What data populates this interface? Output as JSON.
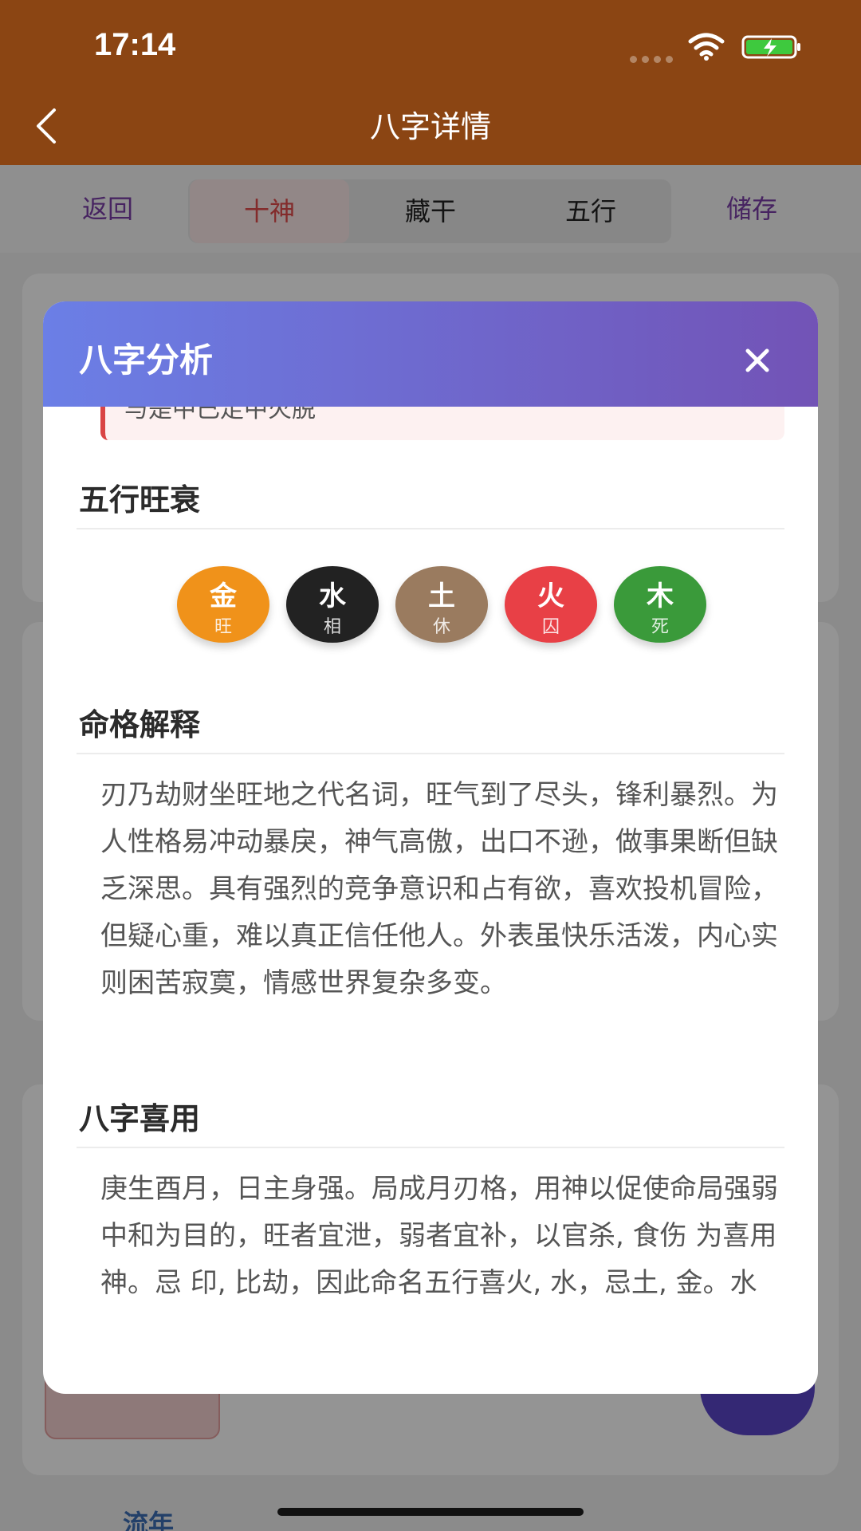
{
  "status_bar": {
    "time": "17:14"
  },
  "header": {
    "title": "八字详情"
  },
  "toolbar": {
    "back_label": "返回",
    "tabs": [
      {
        "label": "十神"
      },
      {
        "label": "藏干"
      },
      {
        "label": "五行"
      }
    ],
    "save_label": "储存"
  },
  "background": {
    "bottom_tab_label": "流年"
  },
  "modal": {
    "title": "八字分析",
    "note_text": "与是中已走中火脱",
    "wuxing": {
      "title": "五行旺衰",
      "elements": [
        {
          "name": "金",
          "state": "旺",
          "color": "#f0921a"
        },
        {
          "name": "水",
          "state": "相",
          "color": "#222222"
        },
        {
          "name": "土",
          "state": "休",
          "color": "#9a7b5f"
        },
        {
          "name": "火",
          "state": "囚",
          "color": "#e84046"
        },
        {
          "name": "木",
          "state": "死",
          "color": "#3a9a3a"
        }
      ]
    },
    "mingge": {
      "title": "命格解释",
      "text": "刃乃劫财坐旺地之代名词，旺气到了尽头，锋利暴烈。为人性格易冲动暴戾，神气高傲，出口不逊，做事果断但缺乏深思。具有强烈的竞争意识和占有欲，喜欢投机冒险，但疑心重，难以真正信任他人。外表虽快乐活泼，内心实则困苦寂寞，情感世界复杂多变。"
    },
    "xiyong": {
      "title": "八字喜用",
      "text": "庚生酉月，日主身强。局成月刃格，用神以促使命局强弱中和为目的，旺者宜泄，弱者宜补，以官杀, 食伤 为喜用神。忌 印, 比劫，因此命名五行喜火, 水，忌土, 金。水"
    }
  }
}
